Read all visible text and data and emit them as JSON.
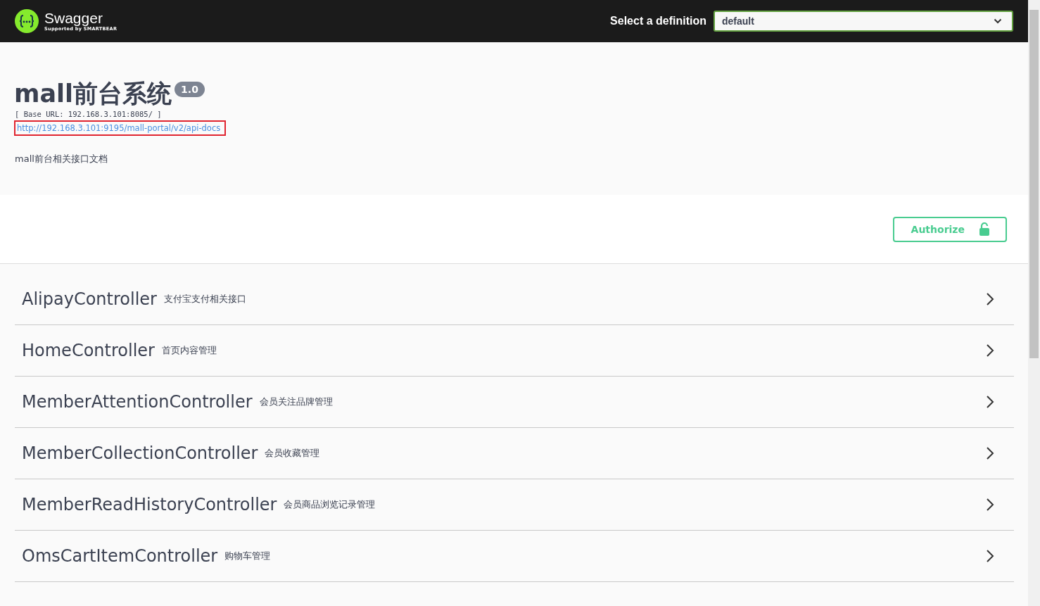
{
  "topbar": {
    "brand": "Swagger",
    "tagline": "Supported by SMARTBEAR",
    "definition_label": "Select a definition",
    "definition_value": "default"
  },
  "info": {
    "title": "mall前台系统",
    "version": "1.0",
    "base_url": "[ Base URL: 192.168.3.101:8085/ ]",
    "spec_url": "http://192.168.3.101:9195/mall-portal/v2/api-docs",
    "spec_url_highlighted": true,
    "description": "mall前台相关接口文档"
  },
  "authorize": {
    "label": "Authorize"
  },
  "tags": [
    {
      "name": "AlipayController",
      "description": "支付宝支付相关接口",
      "expanded": false
    },
    {
      "name": "HomeController",
      "description": "首页内容管理",
      "expanded": false
    },
    {
      "name": "MemberAttentionController",
      "description": "会员关注品牌管理",
      "expanded": false
    },
    {
      "name": "MemberCollectionController",
      "description": "会员收藏管理",
      "expanded": false
    },
    {
      "name": "MemberReadHistoryController",
      "description": "会员商品浏览记录管理",
      "expanded": false
    },
    {
      "name": "OmsCartItemController",
      "description": "购物车管理",
      "expanded": false
    }
  ]
}
